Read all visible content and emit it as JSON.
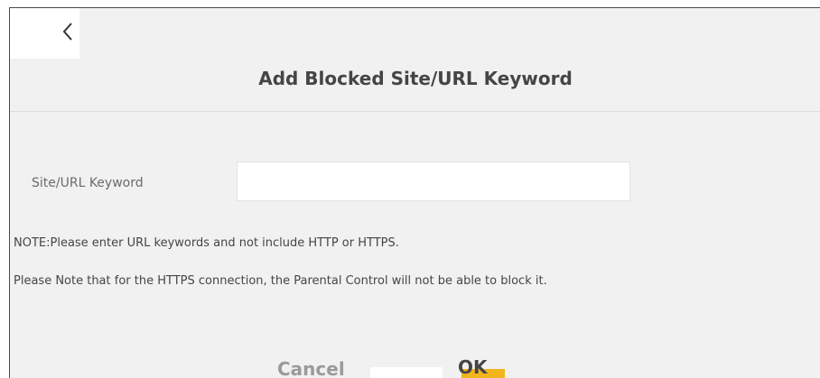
{
  "caption": "",
  "dialog": {
    "back_icon": "chevron-left-icon",
    "title": "Add Blocked Site/URL Keyword",
    "field_label": "Site/URL Keyword",
    "field_value": "",
    "note1": "NOTE:Please enter URL keywords and not include HTTP or HTTPS.",
    "note2": "Please Note that for the HTTPS connection, the Parental Control will not be able to block it.",
    "cancel_label": "Cancel",
    "ok_label": "OK"
  },
  "colors": {
    "dialog_bg": "#f1f1f1",
    "accent": "#f2b51d",
    "title": "#454545",
    "muted": "#9a9a9a"
  }
}
